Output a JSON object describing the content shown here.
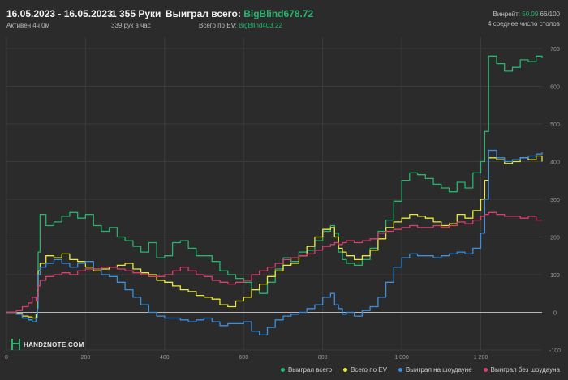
{
  "header": {
    "date_range": "16.05.2023 - 16.05.2023",
    "active_time": "Активен 4ч 0м",
    "hands": "1 355 Руки",
    "hands_per_hour": "339 рук в час",
    "won_total_label": "Выиграл всего:",
    "won_total_value": "BigBlind678.72",
    "ev_total_label": "Всего по EV:",
    "ev_total_value": "BigBlind403.22",
    "winrate_label": "Винрейт:",
    "winrate_value": "50.09",
    "winrate_suffix": "66/100",
    "avg_tables": "4 среднее число столов"
  },
  "watermark": "HAND2NOTE.COM",
  "colors": {
    "background": "#2b2b2b",
    "grid": "#3b3b3b",
    "zero_line": "#b8b8b8",
    "accent": "#27b56e"
  },
  "legend": {
    "items": [
      {
        "label": "Выиграл всего",
        "color": "#27b56e"
      },
      {
        "label": "Всего по EV",
        "color": "#e9e93a"
      },
      {
        "label": "Выиграл на шоудауне",
        "color": "#3a8fe0"
      },
      {
        "label": "Выиграл без шоудауна",
        "color": "#d9406c"
      }
    ]
  },
  "chart_data": {
    "type": "line",
    "title": "",
    "xlabel": "",
    "ylabel": "",
    "xlim": [
      0,
      1355
    ],
    "ylim": [
      -100,
      730
    ],
    "grid": true,
    "legend_position": "bottom-right",
    "x_ticks": [
      0,
      200,
      400,
      600,
      800,
      1000,
      1200
    ],
    "x_tick_labels": [
      "0",
      "200",
      "400",
      "600",
      "800",
      "1 000",
      "1 200"
    ],
    "y_ticks": [
      -100,
      0,
      100,
      200,
      300,
      400,
      500,
      600,
      700
    ],
    "y_tick_labels": [
      "-100",
      "0",
      "100",
      "200",
      "300",
      "400",
      "500",
      "600",
      "700"
    ],
    "series": [
      {
        "name": "Выиграл всего",
        "color": "#27b56e",
        "x": [
          0,
          25,
          40,
          55,
          65,
          75,
          78,
          80,
          85,
          100,
          120,
          140,
          160,
          180,
          200,
          220,
          240,
          260,
          280,
          300,
          320,
          340,
          360,
          380,
          400,
          420,
          440,
          460,
          480,
          500,
          520,
          540,
          560,
          580,
          600,
          620,
          640,
          660,
          680,
          700,
          720,
          740,
          760,
          780,
          800,
          820,
          830,
          840,
          850,
          860,
          880,
          900,
          920,
          940,
          960,
          980,
          1000,
          1020,
          1040,
          1060,
          1080,
          1100,
          1120,
          1140,
          1160,
          1180,
          1200,
          1210,
          1220,
          1240,
          1260,
          1280,
          1300,
          1320,
          1340,
          1355
        ],
        "values": [
          0,
          -5,
          -15,
          -20,
          -25,
          -10,
          60,
          160,
          260,
          230,
          240,
          255,
          265,
          250,
          260,
          230,
          215,
          225,
          200,
          190,
          175,
          160,
          185,
          145,
          150,
          185,
          190,
          170,
          150,
          150,
          135,
          110,
          100,
          90,
          80,
          60,
          50,
          80,
          115,
          145,
          135,
          160,
          165,
          190,
          215,
          230,
          210,
          160,
          140,
          130,
          125,
          140,
          170,
          215,
          245,
          295,
          350,
          370,
          365,
          355,
          340,
          330,
          320,
          345,
          330,
          370,
          400,
          480,
          680,
          660,
          640,
          650,
          670,
          665,
          680,
          675
        ]
      },
      {
        "name": "Всего по EV",
        "color": "#e9e93a",
        "x": [
          0,
          25,
          40,
          55,
          65,
          75,
          78,
          80,
          85,
          100,
          120,
          140,
          160,
          180,
          200,
          220,
          240,
          260,
          280,
          300,
          320,
          340,
          360,
          380,
          400,
          420,
          440,
          460,
          480,
          500,
          520,
          540,
          560,
          580,
          600,
          620,
          640,
          660,
          680,
          700,
          720,
          740,
          760,
          780,
          800,
          820,
          830,
          840,
          850,
          860,
          880,
          900,
          920,
          940,
          960,
          980,
          1000,
          1020,
          1040,
          1060,
          1080,
          1100,
          1120,
          1140,
          1160,
          1180,
          1200,
          1210,
          1220,
          1240,
          1260,
          1280,
          1300,
          1320,
          1340,
          1355
        ],
        "values": [
          0,
          -3,
          -10,
          -12,
          -15,
          -5,
          40,
          110,
          130,
          150,
          145,
          155,
          140,
          135,
          120,
          110,
          115,
          120,
          125,
          130,
          115,
          105,
          100,
          85,
          80,
          70,
          60,
          55,
          45,
          40,
          35,
          20,
          15,
          30,
          40,
          60,
          75,
          95,
          110,
          125,
          130,
          150,
          175,
          200,
          220,
          225,
          200,
          170,
          160,
          150,
          140,
          150,
          165,
          195,
          225,
          240,
          250,
          260,
          255,
          250,
          240,
          230,
          235,
          260,
          250,
          270,
          300,
          350,
          410,
          405,
          395,
          400,
          410,
          405,
          415,
          400
        ]
      },
      {
        "name": "Выиграл на шоудауне",
        "color": "#3a8fe0",
        "x": [
          0,
          25,
          40,
          55,
          65,
          75,
          78,
          80,
          85,
          100,
          120,
          140,
          160,
          180,
          200,
          220,
          240,
          260,
          280,
          300,
          320,
          340,
          360,
          380,
          400,
          420,
          440,
          460,
          480,
          500,
          520,
          540,
          560,
          580,
          600,
          620,
          640,
          660,
          680,
          700,
          720,
          740,
          760,
          780,
          800,
          820,
          830,
          840,
          850,
          860,
          880,
          900,
          920,
          940,
          960,
          980,
          1000,
          1020,
          1040,
          1060,
          1080,
          1100,
          1120,
          1140,
          1160,
          1180,
          1200,
          1210,
          1220,
          1240,
          1260,
          1280,
          1300,
          1320,
          1340,
          1355
        ],
        "values": [
          0,
          -5,
          -15,
          -20,
          -25,
          -15,
          10,
          100,
          120,
          130,
          140,
          130,
          120,
          130,
          135,
          115,
          100,
          95,
          80,
          60,
          40,
          20,
          0,
          -10,
          -15,
          -15,
          -20,
          -25,
          -20,
          -15,
          -25,
          -35,
          -30,
          -30,
          -25,
          -50,
          -60,
          -40,
          -20,
          -10,
          -5,
          0,
          10,
          20,
          40,
          50,
          20,
          10,
          -5,
          0,
          -10,
          5,
          15,
          40,
          80,
          120,
          145,
          155,
          150,
          150,
          145,
          150,
          155,
          160,
          155,
          170,
          210,
          300,
          430,
          410,
          400,
          405,
          410,
          415,
          420,
          425
        ]
      },
      {
        "name": "Выиграл без шоудауна",
        "color": "#d9406c",
        "x": [
          0,
          25,
          40,
          55,
          65,
          75,
          78,
          80,
          85,
          100,
          120,
          140,
          160,
          180,
          200,
          220,
          240,
          260,
          280,
          300,
          320,
          340,
          360,
          380,
          400,
          420,
          440,
          460,
          480,
          500,
          520,
          540,
          560,
          580,
          600,
          620,
          640,
          660,
          680,
          700,
          720,
          740,
          760,
          780,
          800,
          820,
          830,
          840,
          850,
          860,
          880,
          900,
          920,
          940,
          960,
          980,
          1000,
          1020,
          1040,
          1060,
          1080,
          1100,
          1120,
          1140,
          1160,
          1180,
          1200,
          1210,
          1220,
          1240,
          1260,
          1280,
          1300,
          1320,
          1340,
          1355
        ],
        "values": [
          0,
          5,
          15,
          25,
          40,
          30,
          50,
          70,
          85,
          95,
          100,
          105,
          100,
          110,
          115,
          115,
          120,
          120,
          115,
          110,
          105,
          100,
          95,
          95,
          100,
          110,
          120,
          110,
          100,
          95,
          85,
          80,
          75,
          80,
          85,
          100,
          110,
          120,
          130,
          140,
          145,
          150,
          155,
          165,
          175,
          180,
          185,
          180,
          185,
          190,
          185,
          190,
          195,
          210,
          215,
          220,
          225,
          230,
          225,
          225,
          230,
          225,
          230,
          240,
          235,
          245,
          255,
          260,
          265,
          260,
          255,
          255,
          250,
          255,
          245,
          245
        ]
      }
    ]
  }
}
